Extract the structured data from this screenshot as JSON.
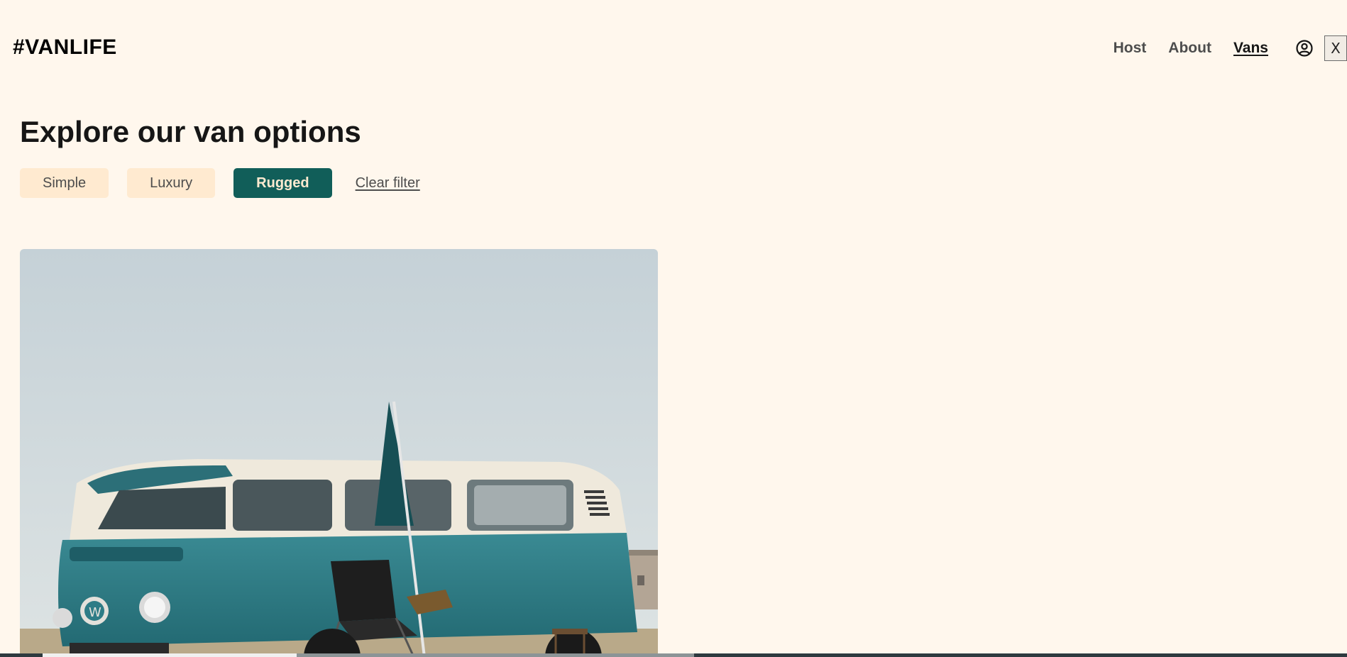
{
  "header": {
    "logo": "#VANLIFE",
    "nav": [
      {
        "label": "Host",
        "active": false
      },
      {
        "label": "About",
        "active": false
      },
      {
        "label": "Vans",
        "active": true
      }
    ],
    "user_icon": "user-circle-icon",
    "close_label": "X"
  },
  "main": {
    "title": "Explore our van options",
    "filters": [
      {
        "label": "Simple",
        "selected": false
      },
      {
        "label": "Luxury",
        "selected": false
      },
      {
        "label": "Rugged",
        "selected": true
      }
    ],
    "clear_filter": "Clear filter"
  },
  "van_card": {
    "image": "vintage-camper-van-photo",
    "colors": {
      "sky": "#C7D3D8",
      "van_body": "#2E7C86",
      "van_roof": "#EFE9DC"
    }
  },
  "colors": {
    "background": "#FFF7ED",
    "accent": "#115E59",
    "filter_bg": "#FFEAD0"
  }
}
